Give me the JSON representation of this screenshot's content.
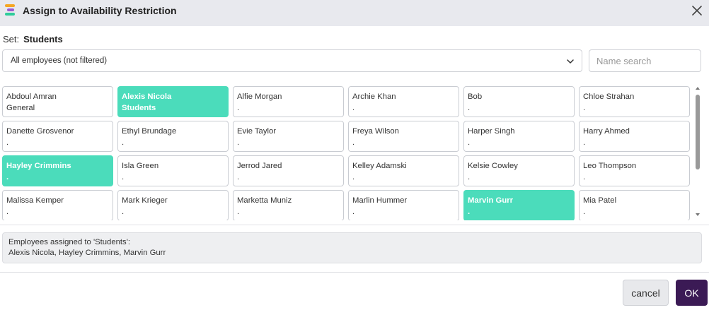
{
  "dialog": {
    "title": "Assign to Availability Restriction",
    "icons": {
      "app": "app-logo-icon",
      "close": "close-icon"
    },
    "colors": {
      "logo_bars": [
        "#f5a623",
        "#9b59d0",
        "#2ecc9a"
      ],
      "selected": "#4bdcbb",
      "ok_button": "#3b1a55",
      "titlebar": "#e8e9ee"
    }
  },
  "set": {
    "label": "Set:",
    "name": "Students"
  },
  "filter": {
    "selected": "All employees (not filtered)",
    "icon": "chevron-down-icon"
  },
  "search": {
    "placeholder": "Name search",
    "value": ""
  },
  "employees": [
    {
      "name": "Abdoul Amran",
      "sub": "General",
      "selected": false
    },
    {
      "name": "Alexis Nicola",
      "sub": "Students",
      "selected": true
    },
    {
      "name": "Alfie Morgan",
      "sub": ".",
      "selected": false
    },
    {
      "name": "Archie Khan",
      "sub": ".",
      "selected": false
    },
    {
      "name": "Bob",
      "sub": ".",
      "selected": false
    },
    {
      "name": "Chloe Strahan",
      "sub": ".",
      "selected": false
    },
    {
      "name": "Danette Grosvenor",
      "sub": ".",
      "selected": false
    },
    {
      "name": "Ethyl Brundage",
      "sub": ".",
      "selected": false
    },
    {
      "name": "Evie Taylor",
      "sub": ".",
      "selected": false
    },
    {
      "name": "Freya Wilson",
      "sub": ".",
      "selected": false
    },
    {
      "name": "Harper Singh",
      "sub": ".",
      "selected": false
    },
    {
      "name": "Harry Ahmed",
      "sub": ".",
      "selected": false
    },
    {
      "name": "Hayley Crimmins",
      "sub": ".",
      "selected": true
    },
    {
      "name": "Isla Green",
      "sub": ".",
      "selected": false
    },
    {
      "name": "Jerrod Jared",
      "sub": ".",
      "selected": false
    },
    {
      "name": "Kelley Adamski",
      "sub": ".",
      "selected": false
    },
    {
      "name": "Kelsie Cowley",
      "sub": ".",
      "selected": false
    },
    {
      "name": "Leo Thompson",
      "sub": ".",
      "selected": false
    },
    {
      "name": "Malissa Kemper",
      "sub": ".",
      "selected": false
    },
    {
      "name": "Mark Krieger",
      "sub": ".",
      "selected": false
    },
    {
      "name": "Marketta Muniz",
      "sub": ".",
      "selected": false
    },
    {
      "name": "Marlin Hummer",
      "sub": ".",
      "selected": false
    },
    {
      "name": "Marvin Gurr",
      "sub": ".",
      "selected": true
    },
    {
      "name": "Mia Patel",
      "sub": ".",
      "selected": false
    }
  ],
  "summary": {
    "heading": "Employees assigned to 'Students':",
    "names": "Alexis Nicola, Hayley Crimmins, Marvin Gurr"
  },
  "footer": {
    "cancel_label": "cancel",
    "ok_label": "OK"
  }
}
